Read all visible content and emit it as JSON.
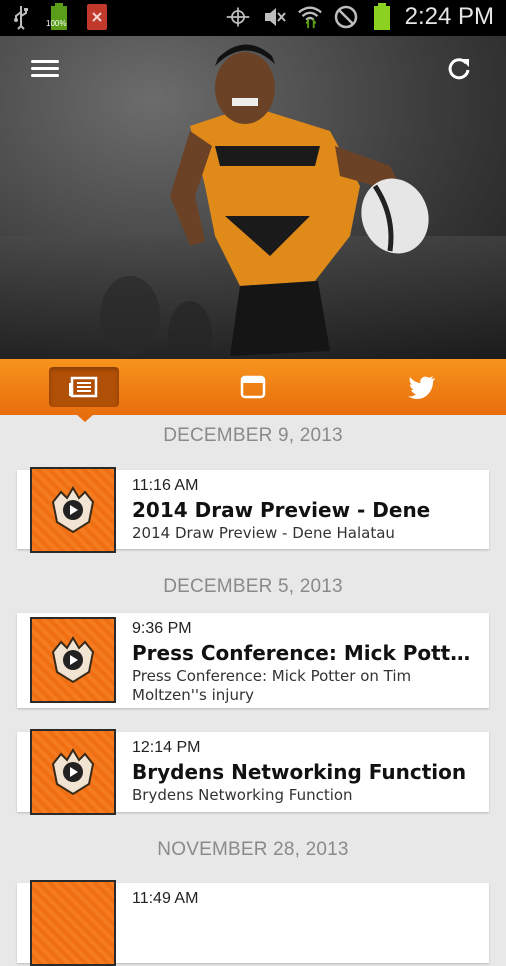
{
  "status_bar": {
    "time": "2:24 PM",
    "battery_label": "100%",
    "icons": [
      "usb-icon",
      "battery-icon",
      "close-notification-icon",
      "rotate-icon",
      "mute-icon",
      "wifi-icon",
      "no-sim-icon",
      "battery-full-icon"
    ]
  },
  "header": {
    "menu_icon": "hamburger-icon",
    "refresh_icon": "refresh-icon"
  },
  "tabs": [
    {
      "name": "news",
      "icon": "newspaper-icon",
      "active": true
    },
    {
      "name": "calendar",
      "icon": "calendar-icon",
      "active": false
    },
    {
      "name": "twitter",
      "icon": "twitter-icon",
      "active": false
    }
  ],
  "colors": {
    "accent": "#f47b20",
    "accent_dark": "#b04f06",
    "background": "#e8e8e8"
  },
  "feed": {
    "sections": [
      {
        "date": "DECEMBER 9, 2013",
        "items": [
          {
            "time": "11:16 AM",
            "title": "2014 Draw Preview - Dene",
            "subtitle": "2014 Draw Preview - Dene Halatau"
          }
        ]
      },
      {
        "date": "DECEMBER 5, 2013",
        "items": [
          {
            "time": "9:36 PM",
            "title": "Press Conference: Mick Potter on Tim Moltzen's injury",
            "subtitle": "Press Conference: Mick Potter on Tim Moltzen''s injury"
          },
          {
            "time": "12:14 PM",
            "title": "Brydens Networking Function",
            "subtitle": "Brydens Networking Function"
          }
        ]
      },
      {
        "date": "NOVEMBER 28, 2013",
        "items": [
          {
            "time": "11:49 AM",
            "title": "",
            "subtitle": ""
          }
        ]
      }
    ]
  }
}
